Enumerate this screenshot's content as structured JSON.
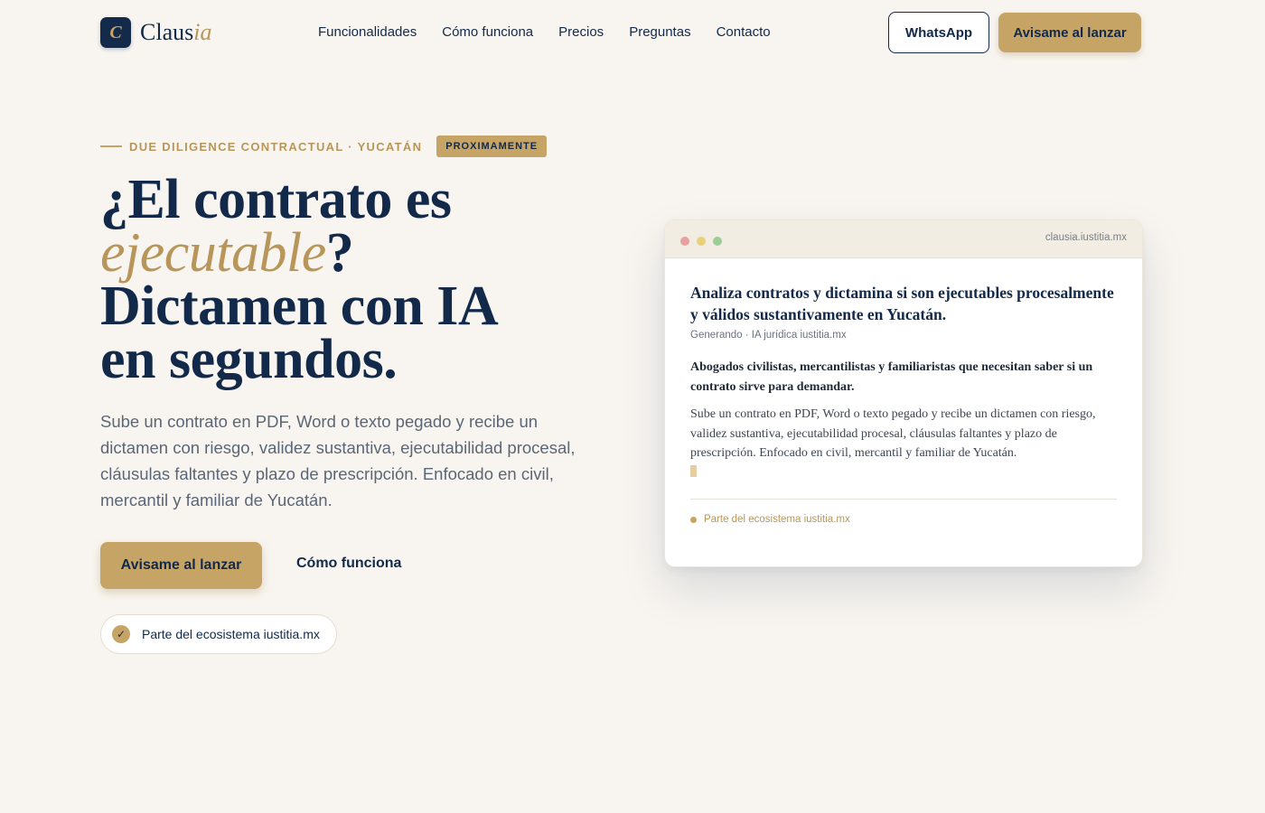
{
  "nav": {
    "logo_mark": "C",
    "logo_main": "Claus",
    "logo_accent": "ia",
    "links": [
      "Funcionalidades",
      "Cómo funciona",
      "Precios",
      "Preguntas",
      "Contacto"
    ],
    "whatsapp_label": "WhatsApp",
    "cta_label": "Avisame al lanzar"
  },
  "hero": {
    "eyebrow": "DUE DILIGENCE CONTRACTUAL · YUCATÁN",
    "badge": "PROXIMAMENTE",
    "headline": {
      "line1": "¿El contrato es",
      "emphasis": "ejecutable",
      "after_emphasis": "?",
      "line3": "Dictamen con IA",
      "line4": "en segundos."
    },
    "lead": "Sube un contrato en PDF, Word o texto pegado y recibe un dictamen con riesgo, validez sustantiva, ejecutabilidad procesal, cláusulas faltantes y plazo de prescripción. Enfocado en civil, mercantil y familiar de Yucatán.",
    "primary_cta": "Avisame al lanzar",
    "secondary_cta": "Cómo funciona",
    "pill": "Parte del ecosistema iustitia.mx",
    "pill_icon": "check-icon"
  },
  "preview": {
    "url": "clausia.iustitia.mx",
    "title": "Analiza contratos y dictamina si son ejecutables procesalmente y válidos sustantivamente en Yucatán.",
    "meta": "Generando · IA jurídica iustitia.mx",
    "audience": "Abogados civilistas, mercantilistas y familiaristas que necesitan saber si un contrato sirve para demandar.",
    "body": "Sube un contrato en PDF, Word o texto pegado y recibe un dictamen con riesgo, validez sustantiva, ejecutabilidad procesal, cláusulas faltantes y plazo de prescripción. Enfocado en civil, mercantil y familiar de Yucatán.",
    "footer": "Parte del ecosistema iustitia.mx"
  },
  "colors": {
    "background": "#f8f5f0",
    "navy": "#12294a",
    "gold": "#c5a466",
    "gold_text": "#b8965a"
  }
}
